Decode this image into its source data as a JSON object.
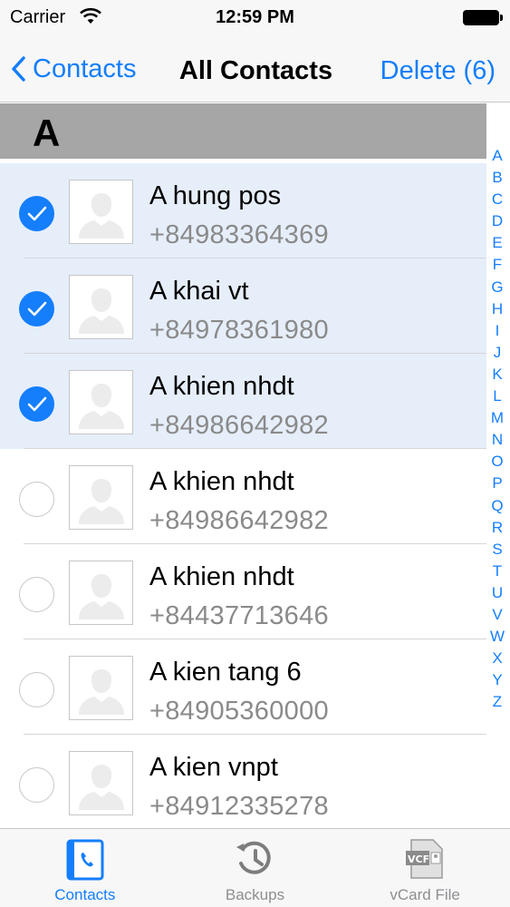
{
  "status_bar": {
    "carrier": "Carrier",
    "time": "12:59 PM"
  },
  "nav_bar": {
    "back_label": "Contacts",
    "title": "All Contacts",
    "delete_label": "Delete (6)"
  },
  "section": {
    "letter": "A"
  },
  "contacts": [
    {
      "name": "A hung pos",
      "phone": "+84983364369",
      "selected": true
    },
    {
      "name": "A khai vt",
      "phone": "+84978361980",
      "selected": true
    },
    {
      "name": "A khien nhdt",
      "phone": "+84986642982",
      "selected": true
    },
    {
      "name": "A khien nhdt",
      "phone": "+84986642982",
      "selected": false
    },
    {
      "name": "A khien nhdt",
      "phone": "+84437713646",
      "selected": false
    },
    {
      "name": "A kien tang 6",
      "phone": "+84905360000",
      "selected": false
    },
    {
      "name": "A kien vnpt",
      "phone": "+84912335278",
      "selected": false
    }
  ],
  "index_letters": [
    "A",
    "B",
    "C",
    "D",
    "E",
    "F",
    "G",
    "H",
    "I",
    "J",
    "K",
    "L",
    "M",
    "N",
    "O",
    "P",
    "Q",
    "R",
    "S",
    "T",
    "U",
    "V",
    "W",
    "X",
    "Y",
    "Z"
  ],
  "tabs": [
    {
      "label": "Contacts",
      "icon": "contacts-book-icon",
      "active": true
    },
    {
      "label": "Backups",
      "icon": "history-clock-icon",
      "active": false
    },
    {
      "label": "vCard File",
      "icon": "vcf-file-icon",
      "active": false
    }
  ],
  "colors": {
    "accent": "#147efb",
    "selected_row": "#e6eefa",
    "section_header": "#a6a6a6"
  }
}
